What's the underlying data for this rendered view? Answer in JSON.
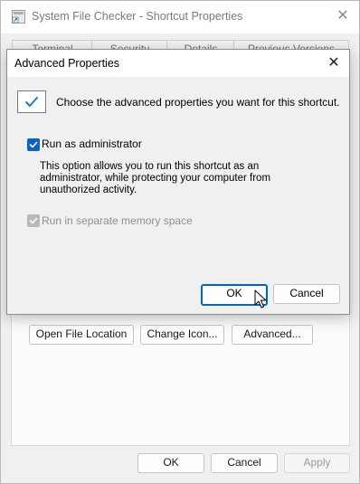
{
  "main_window": {
    "title": "System File Checker - Shortcut Properties",
    "close_glyph": "✕",
    "tabs": [
      "Terminal",
      "Security",
      "Details",
      "Previous Versions"
    ],
    "buttons": {
      "open_file_location": "Open File Location",
      "change_icon": "Change Icon...",
      "advanced": "Advanced..."
    },
    "footer": {
      "ok": "OK",
      "cancel": "Cancel",
      "apply": "Apply"
    }
  },
  "advanced_dialog": {
    "title": "Advanced Properties",
    "close_glyph": "✕",
    "header_text": "Choose the advanced properties you want for this shortcut.",
    "run_as_admin": {
      "label": "Run as administrator",
      "checked": true
    },
    "description": "This option allows you to run this shortcut as an\nadministrator, while protecting your computer from\nunauthorized activity.",
    "separate_memory": {
      "label": "Run in separate memory space",
      "checked": true,
      "disabled": true
    },
    "ok_label": "OK",
    "cancel_label": "Cancel"
  },
  "colors": {
    "accent": "#0a64c8",
    "default_button_border": "#0067c0"
  },
  "icons": [
    "shortcut-icon",
    "close-icon",
    "checkmark-icon",
    "mouse-pointer-icon"
  ]
}
